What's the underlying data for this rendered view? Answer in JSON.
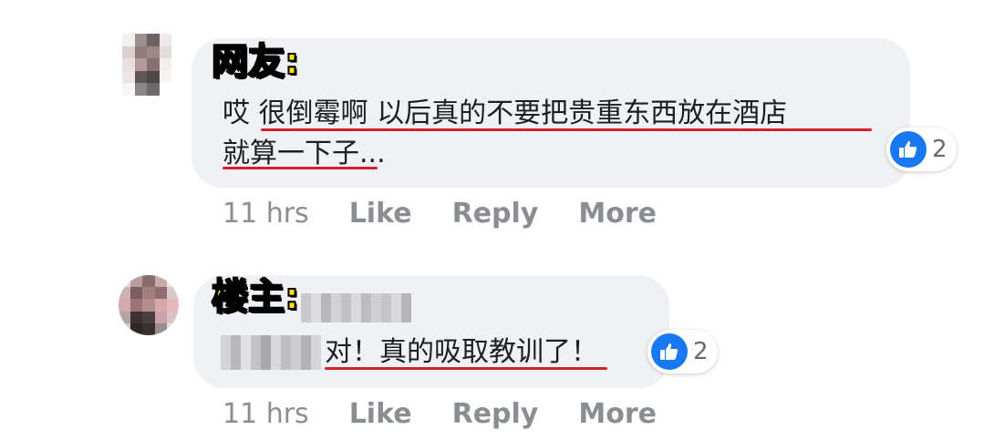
{
  "comments": [
    {
      "author_label": "网友:",
      "text_lines": [
        "哎 很倒霉啊 以后真的不要把贵重东西放在酒店",
        "就算一下子..."
      ],
      "reaction_count": "2",
      "time": "11 hrs",
      "actions": [
        "Like",
        "Reply",
        "More"
      ]
    },
    {
      "author_label": "楼主:",
      "text": "对！真的吸取教训了！",
      "reaction_count": "2",
      "time": "11 hrs",
      "actions": [
        "Like",
        "Reply",
        "More"
      ]
    }
  ],
  "colors": {
    "bubble_bg": "#eff1f4",
    "author_label": "#ffe600",
    "underline": "#d4202c",
    "like_blue": "#1877f2",
    "meta_gray": "#8a8d91"
  },
  "icons": [
    "like-thumb-icon"
  ]
}
